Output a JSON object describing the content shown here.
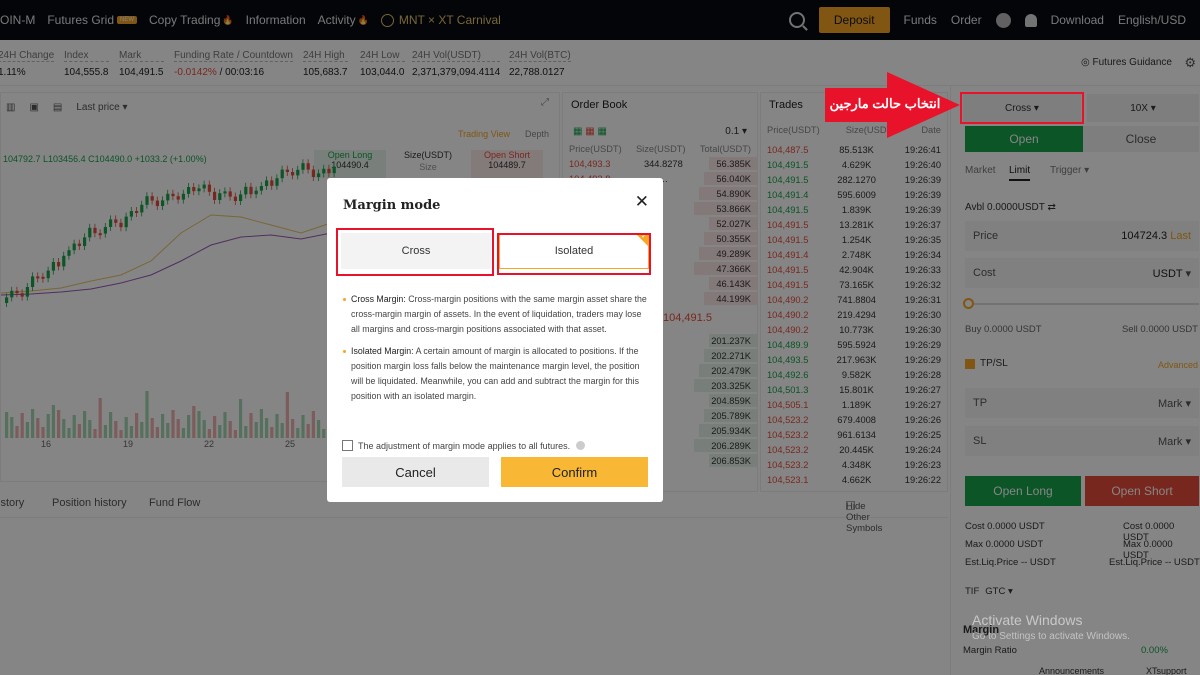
{
  "nav": {
    "items": [
      "OIN-M",
      "Futures Grid",
      "Copy Trading",
      "Information",
      "Activity"
    ],
    "new_badge": "NEW",
    "carnival": "MNT × XT Carnival",
    "deposit": "Deposit",
    "funds": "Funds",
    "order": "Order",
    "download": "Download",
    "language": "English/USD"
  },
  "stats": [
    {
      "label": "24H Change",
      "value": "1.11%"
    },
    {
      "label": "Index",
      "value": "104,555.8"
    },
    {
      "label": "Mark",
      "value": "104,491.5"
    },
    {
      "label": "Funding Rate / Countdown",
      "value_red": "-0.0142%",
      "value": " / 00:03:16"
    },
    {
      "label": "24H High",
      "value": "105,683.7"
    },
    {
      "label": "24H Low",
      "value": "103,044.0"
    },
    {
      "label": "24H Vol(USDT)",
      "value": "2,371,379,094.4114"
    },
    {
      "label": "24H Vol(BTC)",
      "value": "22,788.0127"
    }
  ],
  "futures_guidance": "Futures Guidance",
  "chart": {
    "last_price": "Last price",
    "trading_view": "Trading View",
    "depth": "Depth",
    "ohlc": "104792.7  L103456.4  C104490.0  +1033.2 (+1.00%)",
    "open_long": "Open Long",
    "open_long_val": "104490.4",
    "size_label": "Size(USDT)",
    "size_placeholder": "Size",
    "open_short": "Open Short",
    "open_short_val": "104489.7",
    "dates": [
      "16",
      "19",
      "22",
      "25"
    ]
  },
  "order_book": {
    "title": "Order Book",
    "precision": "0.1",
    "headers": [
      "Price(USDT)",
      "Size(USDT)",
      "Total(USDT)"
    ],
    "asks": [
      [
        "104,493.3",
        "344.8278",
        "56.385K"
      ],
      [
        "104,492.8",
        "…",
        "56.040K"
      ],
      [
        "…",
        "…024K",
        "54.890K"
      ],
      [
        "…",
        "…",
        "53.866K"
      ],
      [
        "…",
        "…672K",
        "52.027K"
      ],
      [
        "…",
        "…066K",
        "50.355K"
      ],
      [
        "…",
        "…923K",
        "49.289K"
      ],
      [
        "…",
        "…223K",
        "47.366K"
      ],
      [
        "…",
        "…344K",
        "46.143K"
      ],
      [
        "…",
        "…199K",
        "44.199K"
      ]
    ],
    "mid": "104,491.5",
    "bids": [
      [
        "…",
        "…237K",
        "201.237K"
      ],
      [
        "…",
        "…034K",
        "202.271K"
      ],
      [
        "…",
        "…9782",
        "202.479K"
      ],
      [
        "…",
        "…3592",
        "203.325K"
      ],
      [
        "…",
        "…1095",
        "204.859K"
      ],
      [
        "…",
        "…8676",
        "205.789K"
      ],
      [
        "…",
        "…2825",
        "205.934K"
      ],
      [
        "…",
        "…2568",
        "206.289K"
      ],
      [
        "…",
        "…2298",
        "206.853K"
      ]
    ]
  },
  "trades": {
    "title": "Trades",
    "headers": [
      "Price(USDT)",
      "Size(USDT)",
      "Date"
    ],
    "rows": [
      [
        "104,487.5",
        "85.513K",
        "19:26:41"
      ],
      [
        "104,491.5",
        "4.629K",
        "19:26:40"
      ],
      [
        "104,491.5",
        "282.1270",
        "19:26:39"
      ],
      [
        "104,491.4",
        "595.6009",
        "19:26:39"
      ],
      [
        "104,491.5",
        "1.839K",
        "19:26:39"
      ],
      [
        "104,491.5",
        "13.281K",
        "19:26:37"
      ],
      [
        "104,491.5",
        "1.254K",
        "19:26:35"
      ],
      [
        "104,491.4",
        "2.748K",
        "19:26:34"
      ],
      [
        "104,491.5",
        "42.904K",
        "19:26:33"
      ],
      [
        "104,491.5",
        "73.165K",
        "19:26:32"
      ],
      [
        "104,490.2",
        "741.8804",
        "19:26:31"
      ],
      [
        "104,490.2",
        "219.4294",
        "19:26:30"
      ],
      [
        "104,490.2",
        "10.773K",
        "19:26:30"
      ],
      [
        "104,489.9",
        "595.5924",
        "19:26:29"
      ],
      [
        "104,493.5",
        "217.963K",
        "19:26:29"
      ],
      [
        "104,492.6",
        "9.582K",
        "19:26:28"
      ],
      [
        "104,501.3",
        "15.801K",
        "19:26:27"
      ],
      [
        "104,505.1",
        "1.189K",
        "19:26:27"
      ],
      [
        "104,523.2",
        "679.4008",
        "19:26:26"
      ],
      [
        "104,523.2",
        "961.6134",
        "19:26:25"
      ],
      [
        "104,523.2",
        "20.445K",
        "19:26:24"
      ],
      [
        "104,523.2",
        "4.348K",
        "19:26:23"
      ],
      [
        "104,523.1",
        "4.662K",
        "19:26:22"
      ]
    ]
  },
  "bottom_tabs": [
    "istory",
    "Position history",
    "Fund Flow"
  ],
  "hide_other": "Hide Other Symbols",
  "right_panel": {
    "cross": "Cross",
    "leverage": "10X",
    "open": "Open",
    "close": "Close",
    "order_types": [
      "Market",
      "Limit",
      "Trigger"
    ],
    "avbl": "Avbl 0.0000USDT",
    "price_label": "Price",
    "price_value": "104724.3",
    "last": "Last",
    "cost_label": "Cost",
    "cost_unit": "USDT",
    "buy": "Buy 0.0000 USDT",
    "sell": "Sell 0.0000 USDT",
    "tpsl": "TP/SL",
    "advanced": "Advanced",
    "tp": "TP",
    "sl": "SL",
    "mark": "Mark",
    "open_long": "Open Long",
    "open_short": "Open Short",
    "cost_line": "Cost 0.0000 USDT",
    "max_line": "Max 0.0000 USDT",
    "liq_line": "Est.Liq.Price -- USDT",
    "tif": "TIF",
    "gtc": "GTC",
    "margin": "Margin",
    "margin_ratio": "Margin Ratio",
    "margin_ratio_val": "0.00%",
    "announcements": "Announcements",
    "xtsupport": "XTsupport"
  },
  "annotation": "انتخاب حالت مارجین",
  "watermark": {
    "line1": "Activate Windows",
    "line2": "Go to Settings to activate Windows."
  },
  "modal": {
    "title": "Margin mode",
    "cross": "Cross",
    "isolated": "Isolated",
    "cross_title": "Cross Margin:",
    "cross_desc": "Cross-margin positions with the same margin asset share the cross-margin margin of assets. In the event of liquidation, traders may lose all margins and cross-margin positions associated with that asset.",
    "iso_title": "Isolated Margin:",
    "iso_desc": "A certain amount of margin is allocated to positions. If the position margin loss falls below the maintenance margin level, the position will be liquidated. Meanwhile, you can add and subtract the margin for this position with an isolated margin.",
    "checkbox": "The adjustment of margin mode applies to all futures.",
    "cancel": "Cancel",
    "confirm": "Confirm"
  },
  "colors": {
    "accent": "#f5a623",
    "green": "#16a34a",
    "red": "#e74c3c",
    "annotation": "#e8132a"
  }
}
